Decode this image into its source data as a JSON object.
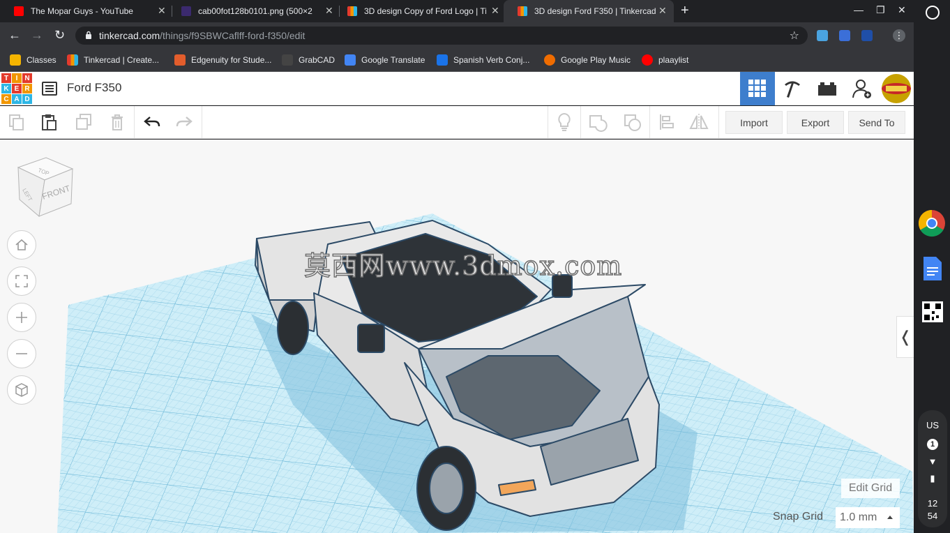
{
  "browser": {
    "tabs": [
      {
        "title": "The Mopar Guys - YouTube",
        "favicon": "youtube-icon",
        "color": "#ff0000",
        "active": false
      },
      {
        "title": "cab00fot128b0101.png (500×2",
        "favicon": "image-icon",
        "color": "#3b2a6e",
        "active": false
      },
      {
        "title": "3D design Copy of Ford Logo | Ti",
        "favicon": "tinkercad-icon",
        "color": "#e0a030",
        "active": false
      },
      {
        "title": "3D design Ford F350 | Tinkercad",
        "favicon": "tinkercad-icon",
        "color": "#e0a030",
        "active": true
      }
    ],
    "url_host": "tinkercad.com",
    "url_path": "/things/f9SBWCaflff-ford-f350/edit",
    "bookmarks": [
      {
        "label": "Classes",
        "color": "#f4b400"
      },
      {
        "label": "Tinkercad | Create...",
        "color": "#e0a030"
      },
      {
        "label": "Edgenuity for Stude...",
        "color": "#e35d2c"
      },
      {
        "label": "GrabCAD",
        "color": "#444444"
      },
      {
        "label": "Google Translate",
        "color": "#4285f4"
      },
      {
        "label": "Spanish Verb Conj...",
        "color": "#1a73e8"
      },
      {
        "label": "Google Play Music",
        "color": "#ef6c00"
      },
      {
        "label": "plaaylist",
        "color": "#ff0000"
      }
    ]
  },
  "tinkercad": {
    "design_title": "Ford F350",
    "logo_letters": [
      "TIN",
      "KER",
      "CAD"
    ],
    "toolbar": {
      "import_label": "Import",
      "export_label": "Export",
      "send_to_label": "Send To"
    },
    "viewcube": {
      "top": "TOP",
      "left": "LEFT",
      "front": "FRONT"
    },
    "watermark": "莫西网www.3dmox.com",
    "edit_grid_label": "Edit Grid",
    "snap_grid_label": "Snap Grid",
    "snap_grid_value": "1.0 mm",
    "colors": {
      "accent": "#3e7ecd",
      "grid": "#a8dcee",
      "grid_line": "#72b9d8"
    }
  },
  "os": {
    "keyboard": "US",
    "notification_count": "1",
    "time_hour": "12",
    "time_minute": "54"
  }
}
